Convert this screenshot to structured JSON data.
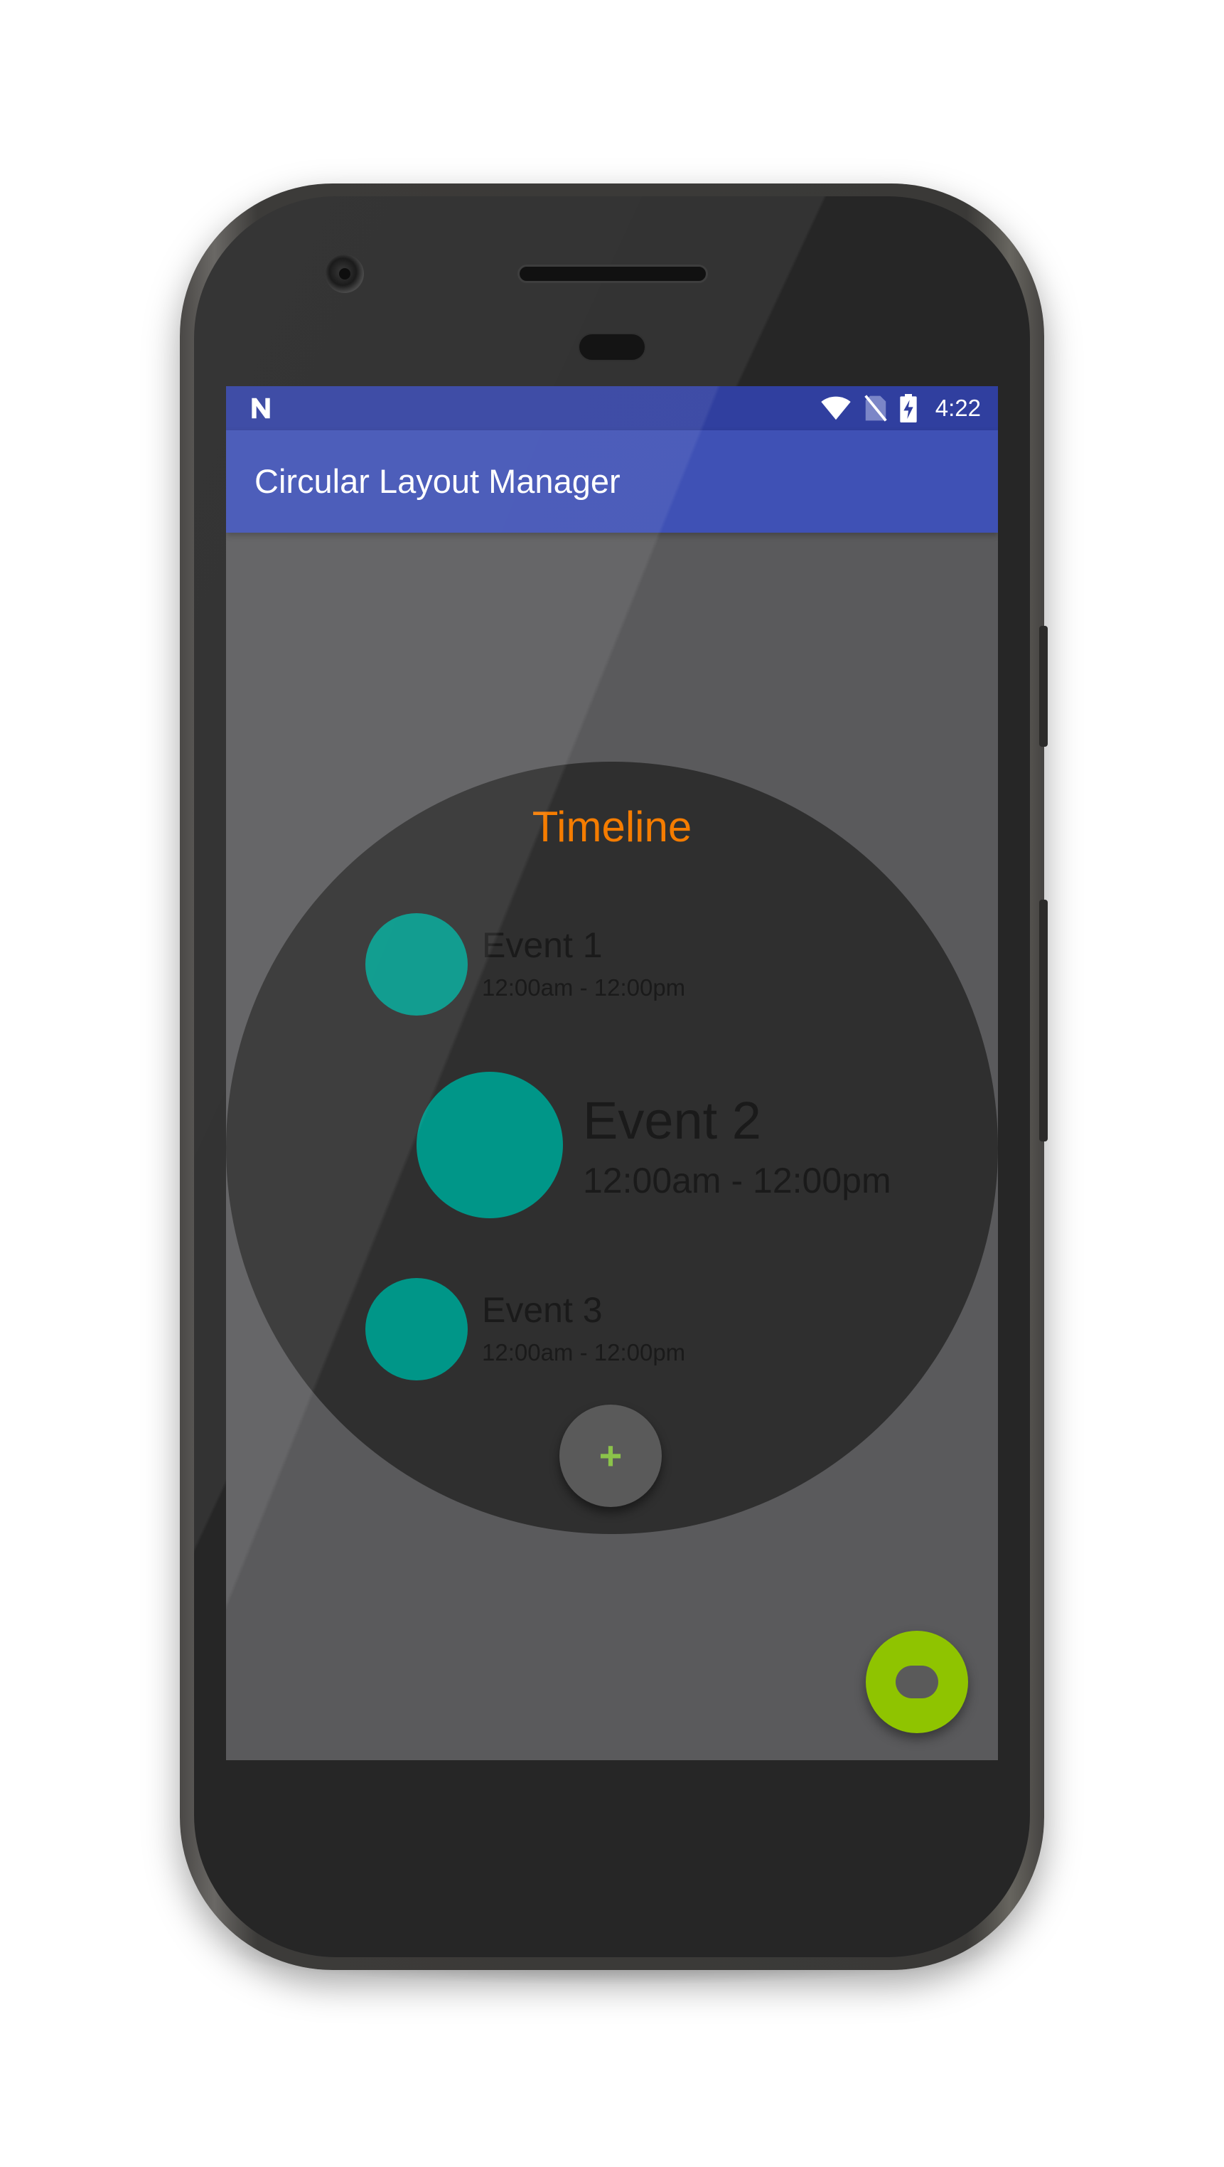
{
  "status_bar": {
    "time": "4:22",
    "icons": [
      "n-notification-icon",
      "wifi-icon",
      "no-sim-icon",
      "battery-charging-icon"
    ]
  },
  "app_bar": {
    "title": "Circular Layout Manager",
    "color": "#3f51b5",
    "status_color": "#303f9f"
  },
  "timeline": {
    "title": "Timeline",
    "title_color": "#f57c00",
    "dot_color": "#009688",
    "events": [
      {
        "name": "Event 1",
        "time": "12:00am - 12:00pm"
      },
      {
        "name": "Event 2",
        "time": "12:00am - 12:00pm"
      },
      {
        "name": "Event 3",
        "time": "12:00am - 12:00pm"
      }
    ],
    "add_button": {
      "glyph": "+",
      "icon": "plus-icon"
    }
  },
  "fab": {
    "icon": "toggle-icon",
    "color": "#8fc400"
  }
}
